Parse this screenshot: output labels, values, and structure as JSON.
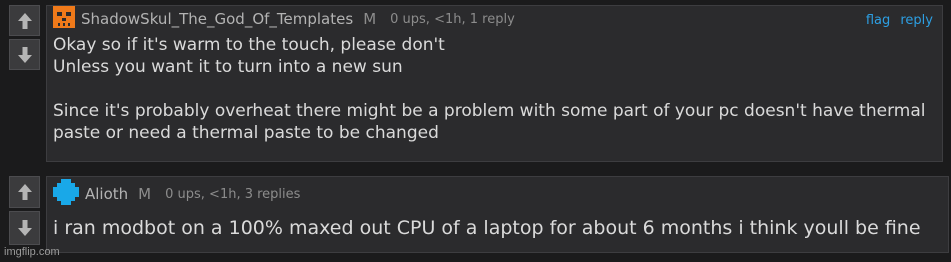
{
  "comments": [
    {
      "username": "ShadowSkul_The_God_Of_Templates",
      "mod_badge": "M",
      "meta": "0 ups, <1h, 1 reply",
      "avatar_icon": "skull-avatar-icon",
      "avatar_color": "#f07a1a",
      "lines": [
        "Okay so if it's warm to the touch, please don't",
        "Unless you want it to turn into a new sun",
        "",
        "Since it's probably overheat there might be a problem with some part of your pc doesn't have thermal",
        "paste or need a thermal paste to be changed"
      ],
      "actions": {
        "flag": "flag",
        "reply": "reply"
      }
    },
    {
      "username": "Alioth",
      "mod_badge": "M",
      "meta": "0 ups, <1h, 3 replies",
      "avatar_icon": "cross-avatar-icon",
      "avatar_color": "#19a8e8",
      "lines": [
        "i ran modbot on a 100% maxed out CPU of a laptop for about 6 months i think youll be fine"
      ]
    }
  ],
  "watermark": "imgflip.com",
  "colors": {
    "link": "#2d9fe3",
    "background": "#1b1b1c",
    "comment_bg": "#2b2b2d"
  }
}
